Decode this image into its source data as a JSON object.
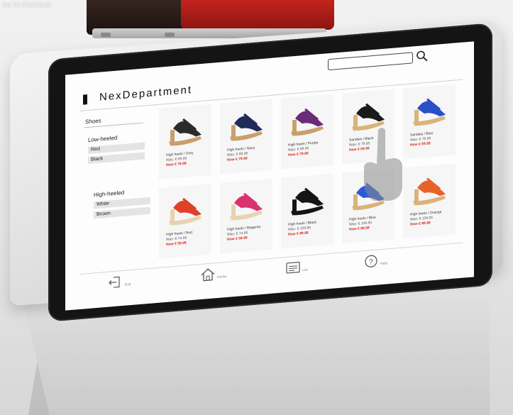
{
  "background": {
    "banner_text": "5% TO PREVIOUS"
  },
  "header": {
    "brand": "NexDepartment",
    "search_placeholder": ""
  },
  "sidebar": {
    "category": "Shoes",
    "sections": [
      {
        "title": "Low-heeled",
        "options": [
          "Red",
          "Black"
        ]
      },
      {
        "title": "High-heeled",
        "options": [
          "White",
          "Brown"
        ]
      }
    ]
  },
  "products": [
    {
      "name": "High heels / Grey",
      "was": "Was: € 99.95",
      "now": "Now € 79.99",
      "color": "#2b2b2b",
      "sole": "#c8a06a"
    },
    {
      "name": "High heels / Navy",
      "was": "Was: € 99.95",
      "now": "Now € 79.99",
      "color": "#1f2a5a",
      "sole": "#c8a06a"
    },
    {
      "name": "High heels / Purple",
      "was": "Was: € 99.95",
      "now": "Now € 79.99",
      "color": "#6a2b7a",
      "sole": "#c8a06a"
    },
    {
      "name": "Sandals / Black",
      "was": "Was: € 79.95",
      "now": "Now € 59.99",
      "color": "#1a1a1a",
      "sole": "#d9b37a"
    },
    {
      "name": "Sandals / Blue",
      "was": "Was: € 79.95",
      "now": "Now € 59.99",
      "color": "#2b4fc7",
      "sole": "#d9b37a"
    },
    {
      "name": "High heels / Red",
      "was": "Was: € 74.95",
      "now": "Now € 59.99",
      "color": "#e0402a",
      "sole": "#e8d2b0"
    },
    {
      "name": "High heels / Magenta",
      "was": "Was: € 74.95",
      "now": "Now € 59.99",
      "color": "#d8336e",
      "sole": "#e8d2b0"
    },
    {
      "name": "High heels / Black",
      "was": "Was: € 109.95",
      "now": "Now € 89.99",
      "color": "#151515",
      "sole": "#151515"
    },
    {
      "name": "High heels / Blue",
      "was": "Was: € 109.95",
      "now": "Now € 89.99",
      "color": "#2b5ad8",
      "sole": "#d9b37a"
    },
    {
      "name": "High heels / Orange",
      "was": "Was: € 109.95",
      "now": "Now € 89.99",
      "color": "#e8632a",
      "sole": "#d9b37a"
    }
  ],
  "footer": {
    "exit_label": "Exit",
    "home_label": "Home",
    "list_label": "List",
    "help_label": "Help"
  },
  "colors": {
    "price_now": "#d8261b",
    "box": "#c9261f"
  }
}
